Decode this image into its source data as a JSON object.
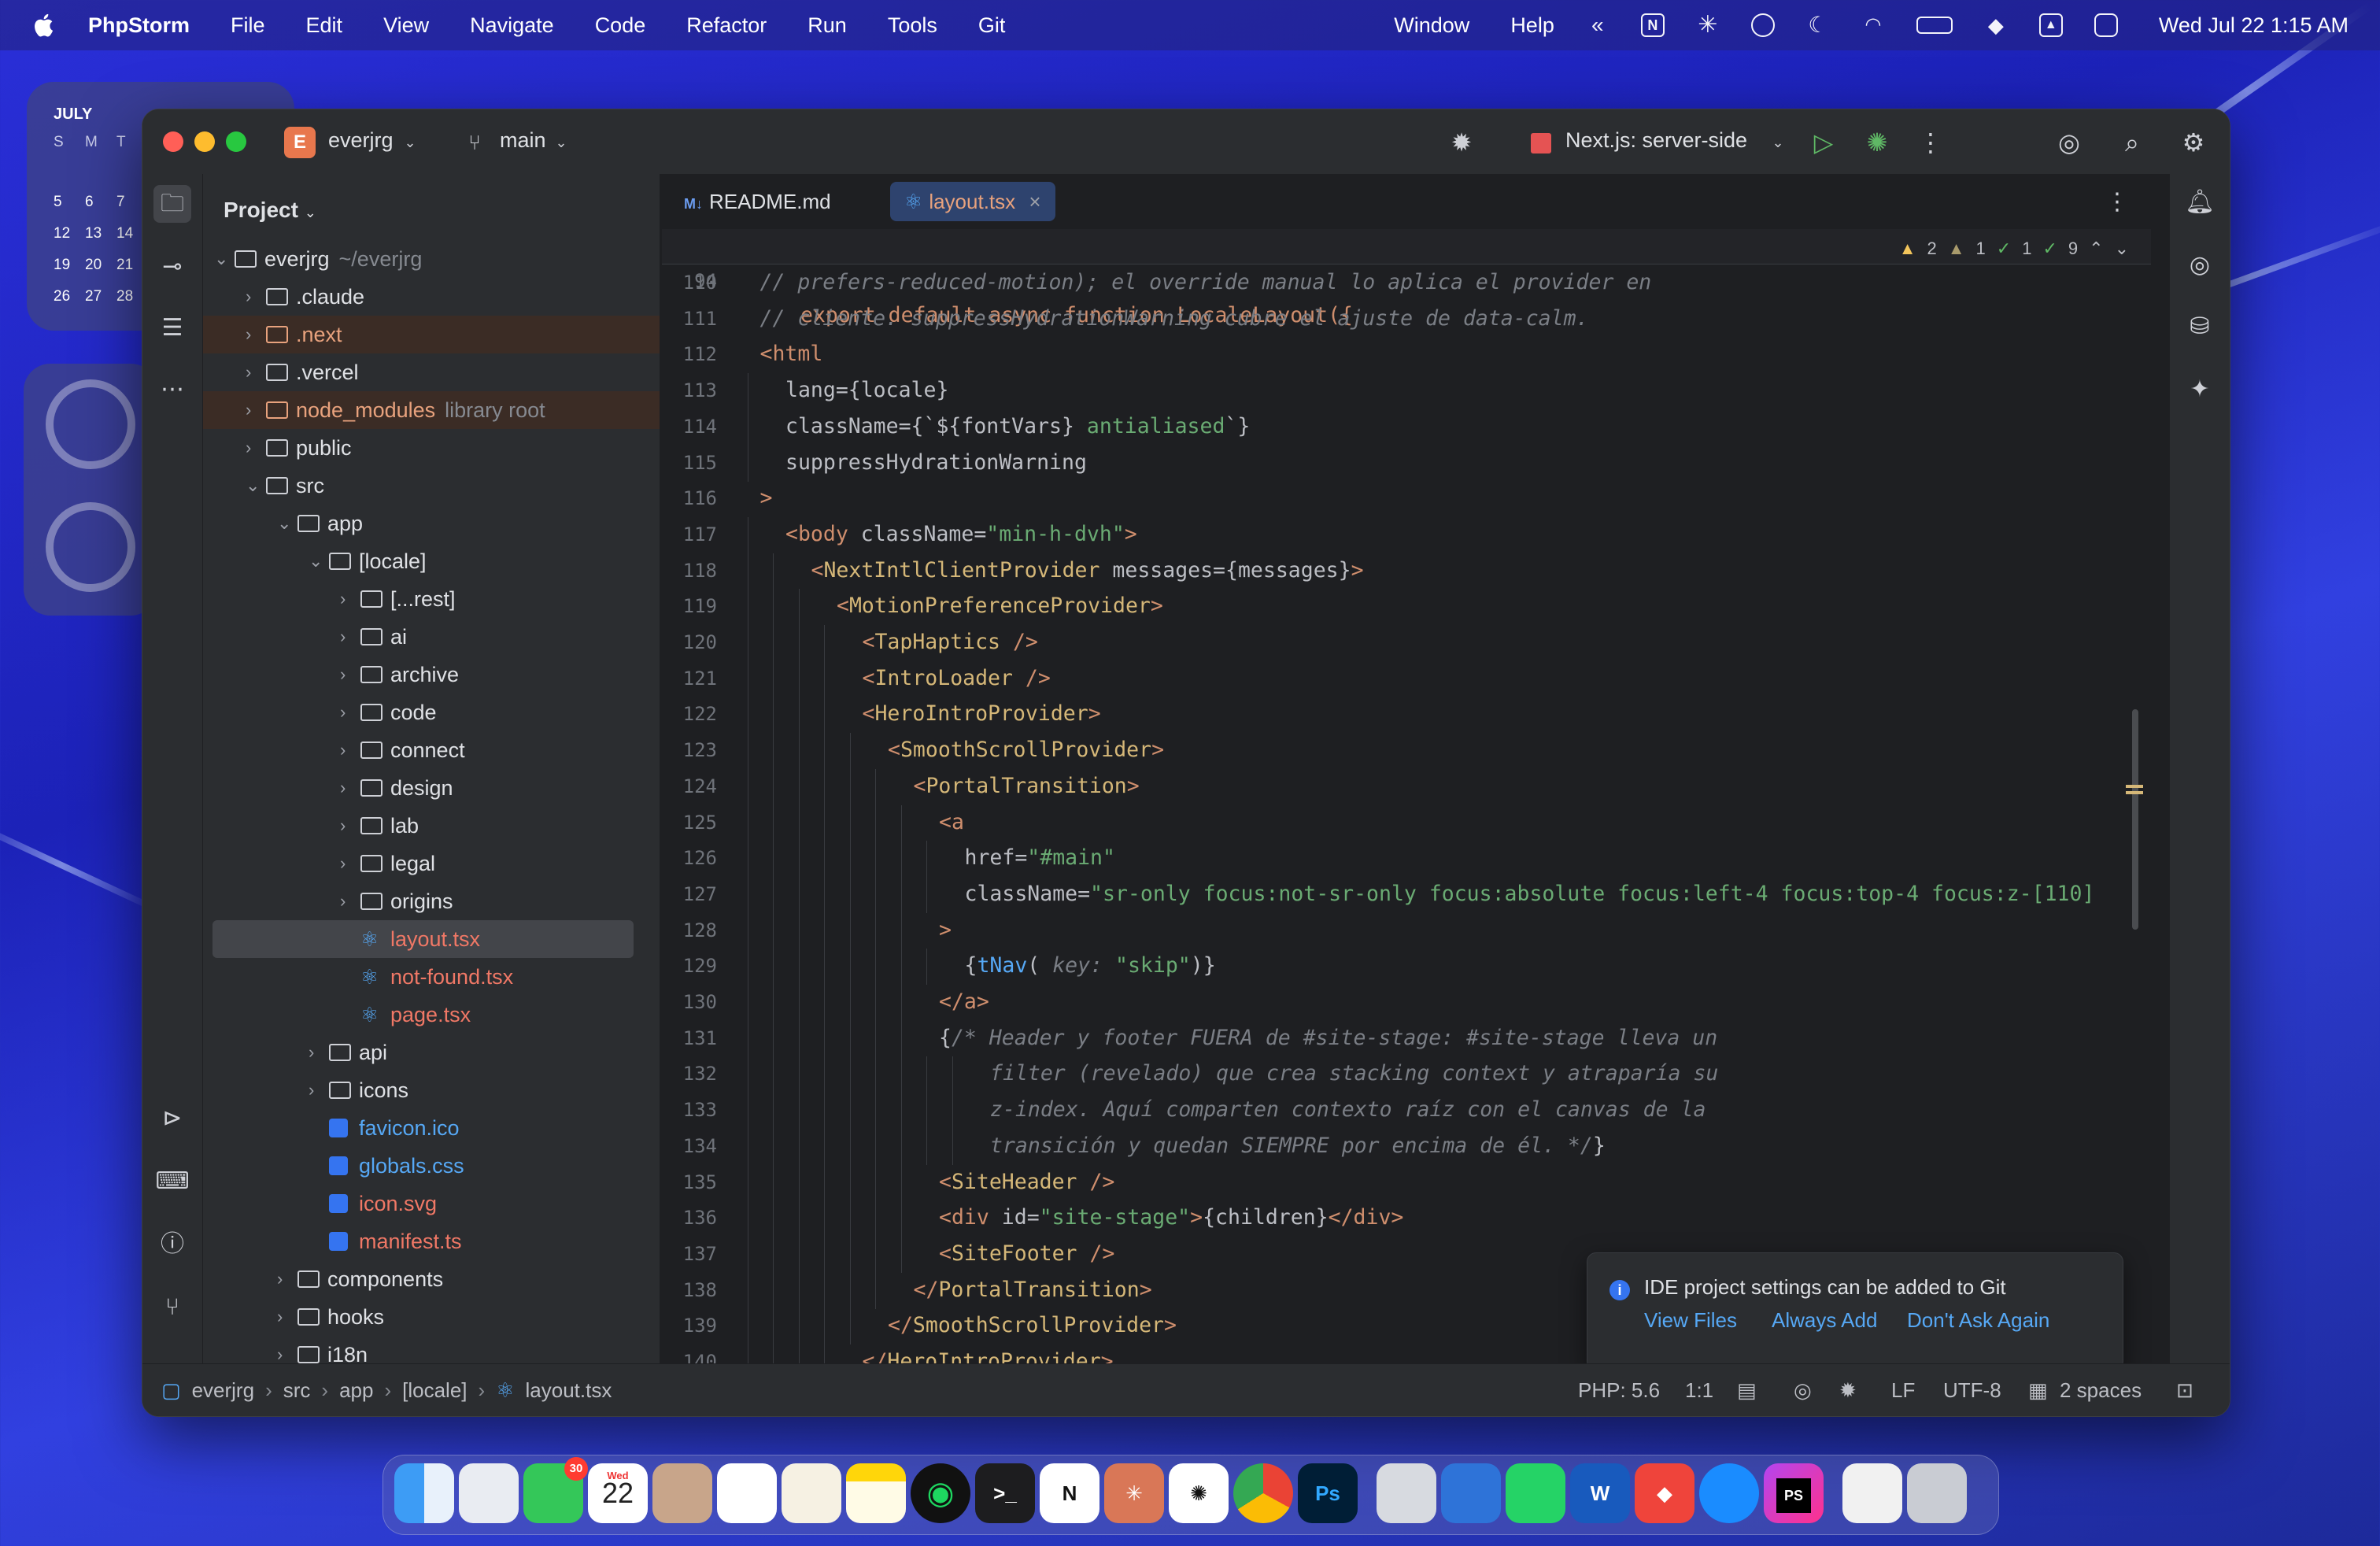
{
  "menubar": {
    "app_name": "PhpStorm",
    "menus": [
      "File",
      "Edit",
      "View",
      "Navigate",
      "Code",
      "Refactor",
      "Run",
      "Tools",
      "Git"
    ],
    "right_menus": [
      "Window",
      "Help"
    ],
    "datetime": "Wed Jul 22  1:15 AM"
  },
  "calendar_widget": {
    "month": "JULY",
    "weekday_header": [
      "S",
      "M",
      "T"
    ],
    "rows": [
      [
        "5",
        "6",
        "7"
      ],
      [
        "12",
        "13",
        "14"
      ],
      [
        "19",
        "20",
        "21"
      ],
      [
        "26",
        "27",
        "28"
      ]
    ]
  },
  "window": {
    "project_badge": "E",
    "project_name": "everjrg",
    "branch": "main",
    "run_config": "Next.js: server-side"
  },
  "project_panel": {
    "title": "Project",
    "tree": [
      {
        "label": "everjrg",
        "hint": "~/everjrg",
        "depth": 0,
        "type": "folder",
        "open": true
      },
      {
        "label": ".claude",
        "depth": 1,
        "type": "folder"
      },
      {
        "label": ".next",
        "depth": 1,
        "type": "folder",
        "ignored": true
      },
      {
        "label": ".vercel",
        "depth": 1,
        "type": "folder"
      },
      {
        "label": "node_modules",
        "hint": "library root",
        "depth": 1,
        "type": "folder",
        "ignored": true
      },
      {
        "label": "public",
        "depth": 1,
        "type": "folder"
      },
      {
        "label": "src",
        "depth": 1,
        "type": "folder",
        "open": true
      },
      {
        "label": "app",
        "depth": 2,
        "type": "folder",
        "open": true
      },
      {
        "label": "[locale]",
        "depth": 3,
        "type": "folder",
        "open": true
      },
      {
        "label": "[...rest]",
        "depth": 4,
        "type": "folder"
      },
      {
        "label": "ai",
        "depth": 4,
        "type": "folder"
      },
      {
        "label": "archive",
        "depth": 4,
        "type": "folder"
      },
      {
        "label": "code",
        "depth": 4,
        "type": "folder"
      },
      {
        "label": "connect",
        "depth": 4,
        "type": "folder"
      },
      {
        "label": "design",
        "depth": 4,
        "type": "folder"
      },
      {
        "label": "lab",
        "depth": 4,
        "type": "folder"
      },
      {
        "label": "legal",
        "depth": 4,
        "type": "folder"
      },
      {
        "label": "origins",
        "depth": 4,
        "type": "folder"
      },
      {
        "label": "layout.tsx",
        "depth": 4,
        "type": "react",
        "selected": true
      },
      {
        "label": "not-found.tsx",
        "depth": 4,
        "type": "react"
      },
      {
        "label": "page.tsx",
        "depth": 4,
        "type": "react"
      },
      {
        "label": "api",
        "depth": 3,
        "type": "folder"
      },
      {
        "label": "icons",
        "depth": 3,
        "type": "folder"
      },
      {
        "label": "favicon.ico",
        "depth": 3,
        "type": "file",
        "color": "blue"
      },
      {
        "label": "globals.css",
        "depth": 3,
        "type": "file",
        "color": "blue"
      },
      {
        "label": "icon.svg",
        "depth": 3,
        "type": "file",
        "color": "red"
      },
      {
        "label": "manifest.ts",
        "depth": 3,
        "type": "file",
        "color": "red"
      },
      {
        "label": "components",
        "depth": 2,
        "type": "folder"
      },
      {
        "label": "hooks",
        "depth": 2,
        "type": "folder"
      },
      {
        "label": "i18n",
        "depth": 2,
        "type": "folder"
      }
    ]
  },
  "editor": {
    "tabs": [
      {
        "label": "README.md",
        "prefix": "M↓",
        "active": false
      },
      {
        "label": "layout.tsx",
        "active": true
      }
    ],
    "inspections": {
      "warnings": "2",
      "weak": "1",
      "typos": "1",
      "ok": "9"
    },
    "sticky_line": {
      "num": "94",
      "text": "export default async function LocaleLayout({"
    },
    "lines": [
      {
        "num": "110",
        "indent": 1,
        "html": "<span class='c'>// prefers-reduced-motion); el override manual lo aplica el provider en</span>"
      },
      {
        "num": "111",
        "indent": 1,
        "html": "<span class='c'>// cliente. suppressHydrationWarning cubre el ajuste de data-calm.</span>"
      },
      {
        "num": "112",
        "indent": 1,
        "html": "<span class='k'>&lt;html</span>"
      },
      {
        "num": "113",
        "indent": 2,
        "html": "<span class='p'>lang={locale}</span>"
      },
      {
        "num": "114",
        "indent": 2,
        "html": "<span class='p'>className={`${fontVars} </span><span class='s'>antialiased</span><span class='p'>`}</span>"
      },
      {
        "num": "115",
        "indent": 2,
        "html": "<span class='p'>suppressHydrationWarning</span>"
      },
      {
        "num": "116",
        "indent": 1,
        "html": "<span class='k'>&gt;</span>"
      },
      {
        "num": "117",
        "indent": 2,
        "html": "<span class='k'>&lt;body </span><span class='p'>className=</span><span class='s'>\"min-h-dvh\"</span><span class='k'>&gt;</span>"
      },
      {
        "num": "118",
        "indent": 3,
        "html": "<span class='k'>&lt;</span><span class='t'>NextIntlClientProvider </span><span class='p'>messages={messages}</span><span class='k'>&gt;</span>"
      },
      {
        "num": "119",
        "indent": 4,
        "html": "<span class='k'>&lt;</span><span class='t'>MotionPreferenceProvider</span><span class='k'>&gt;</span>"
      },
      {
        "num": "120",
        "indent": 5,
        "html": "<span class='k'>&lt;</span><span class='t'>TapHaptics </span><span class='k'>/&gt;</span>"
      },
      {
        "num": "121",
        "indent": 5,
        "html": "<span class='k'>&lt;</span><span class='t'>IntroLoader </span><span class='k'>/&gt;</span>"
      },
      {
        "num": "122",
        "indent": 5,
        "html": "<span class='k'>&lt;</span><span class='t'>HeroIntroProvider</span><span class='k'>&gt;</span>"
      },
      {
        "num": "123",
        "indent": 6,
        "html": "<span class='k'>&lt;</span><span class='t'>SmoothScrollProvider</span><span class='k'>&gt;</span>"
      },
      {
        "num": "124",
        "indent": 7,
        "html": "<span class='k'>&lt;</span><span class='t'>PortalTransition</span><span class='k'>&gt;</span>"
      },
      {
        "num": "125",
        "indent": 8,
        "html": "<span class='k'>&lt;a</span>"
      },
      {
        "num": "126",
        "indent": 9,
        "html": "<span class='p'>href=</span><span class='s'>\"#main\"</span>"
      },
      {
        "num": "127",
        "indent": 9,
        "html": "<span class='p'>className=</span><span class='s'>\"sr-only focus:not-sr-only focus:absolute focus:left-4 focus:top-4 focus:z-[110]</span>"
      },
      {
        "num": "128",
        "indent": 8,
        "html": "<span class='k'>&gt;</span>"
      },
      {
        "num": "129",
        "indent": 9,
        "html": "<span class='p'>{</span><span class='f'>tNav</span><span class='p'>( </span><span class='c'>key:</span><span class='s'> \"skip\"</span><span class='p'>)}</span>"
      },
      {
        "num": "130",
        "indent": 8,
        "html": "<span class='k'>&lt;/a&gt;</span>"
      },
      {
        "num": "131",
        "indent": 8,
        "html": "<span class='p'>{</span><span class='c'>/* Header y footer FUERA de #site-stage: #site-stage lleva un</span>"
      },
      {
        "num": "132",
        "indent": 10,
        "html": "<span class='c'>filter (revelado) que crea stacking context y atraparía su</span>"
      },
      {
        "num": "133",
        "indent": 10,
        "html": "<span class='c'>z-index. Aquí comparten contexto raíz con el canvas de la</span>"
      },
      {
        "num": "134",
        "indent": 10,
        "html": "<span class='c'>transición y quedan SIEMPRE por encima de él. */</span><span class='p'>}</span>"
      },
      {
        "num": "135",
        "indent": 8,
        "html": "<span class='k'>&lt;</span><span class='t'>SiteHeader </span><span class='k'>/&gt;</span>"
      },
      {
        "num": "136",
        "indent": 8,
        "html": "<span class='k'>&lt;div </span><span class='p'>id=</span><span class='s'>\"site-stage\"</span><span class='k'>&gt;</span><span class='p'>{children}</span><span class='k'>&lt;/div&gt;</span>"
      },
      {
        "num": "137",
        "indent": 8,
        "html": "<span class='k'>&lt;</span><span class='t'>SiteFooter </span><span class='k'>/&gt;</span>"
      },
      {
        "num": "138",
        "indent": 7,
        "html": "<span class='k'>&lt;/</span><span class='t'>PortalTransition</span><span class='k'>&gt;</span>"
      },
      {
        "num": "139",
        "indent": 6,
        "html": "<span class='k'>&lt;/</span><span class='t'>SmoothScrollProvider</span><span class='k'>&gt;</span>"
      },
      {
        "num": "140",
        "indent": 5,
        "html": "<span class='k'>&lt;/</span><span class='t'>HeroIntroProvider</span><span class='k'>&gt;</span>"
      }
    ]
  },
  "notification": {
    "message": "IDE project settings can be added to Git",
    "actions": [
      "View Files",
      "Always Add",
      "Don't Ask Again"
    ]
  },
  "statusbar": {
    "breadcrumbs": [
      "everjrg",
      "src",
      "app",
      "[locale]",
      "layout.tsx"
    ],
    "php_version": "PHP: 5.6",
    "position": "1:1",
    "line_ending": "LF",
    "encoding": "UTF-8",
    "indent": "2 spaces"
  },
  "dock": {
    "messages_badge": "30",
    "calendar_day": "22",
    "calendar_weekday": "Wed"
  },
  "colors": {
    "accent": "#3574f0",
    "tag": "#d5b778",
    "keyword": "#cf8e6d",
    "string": "#6aab73"
  }
}
